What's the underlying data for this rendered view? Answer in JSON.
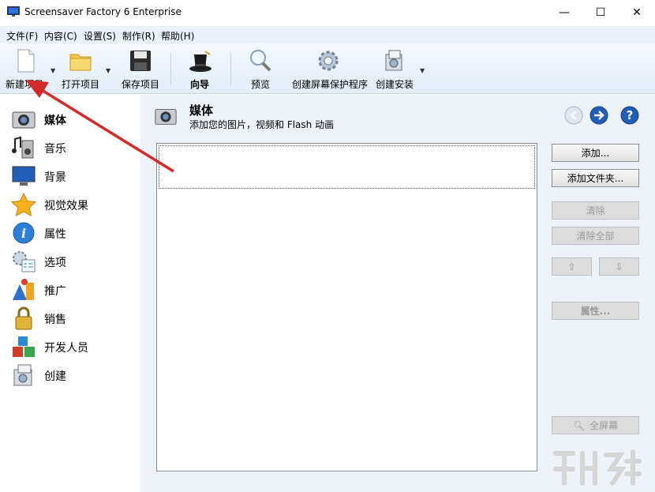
{
  "window": {
    "title": "Screensaver Factory 6 Enterprise",
    "minimize": "—",
    "maximize": "☐",
    "close": "✕"
  },
  "menu": [
    "文件(F)",
    "内容(C)",
    "设置(S)",
    "制作(R)",
    "帮助(H)"
  ],
  "toolbar": {
    "new_project": "新建项目",
    "open_project": "打开项目",
    "save_project": "保存项目",
    "wizard": "向导",
    "preview": "预览",
    "create_screensaver": "创建屏幕保护程序",
    "create_installer": "创建安装"
  },
  "sidebar": {
    "items": [
      {
        "label": "媒体",
        "icon": "camera-icon",
        "active": true
      },
      {
        "label": "音乐",
        "icon": "music-speaker-icon"
      },
      {
        "label": "背景",
        "icon": "monitor-icon"
      },
      {
        "label": "视觉效果",
        "icon": "star-icon"
      },
      {
        "label": "属性",
        "icon": "info-icon"
      },
      {
        "label": "选项",
        "icon": "options-gear-icon"
      },
      {
        "label": "推广",
        "icon": "promo-shapes-icon"
      },
      {
        "label": "销售",
        "icon": "padlock-icon"
      },
      {
        "label": "开发人员",
        "icon": "cubes-icon"
      },
      {
        "label": "创建",
        "icon": "build-package-icon"
      }
    ]
  },
  "content": {
    "title": "媒体",
    "subtitle": "添加您的图片，视频和 Flash 动画",
    "buttons": {
      "add": "添加...",
      "add_folder": "添加文件夹...",
      "clear": "清除",
      "clear_all": "清除全部",
      "up": "⇧",
      "down": "⇩",
      "properties": "属性...",
      "fullscreen": "全屏幕"
    }
  },
  "colors": {
    "accent_blue": "#1f5fb8",
    "annotation_arrow": "#d42a2a"
  }
}
